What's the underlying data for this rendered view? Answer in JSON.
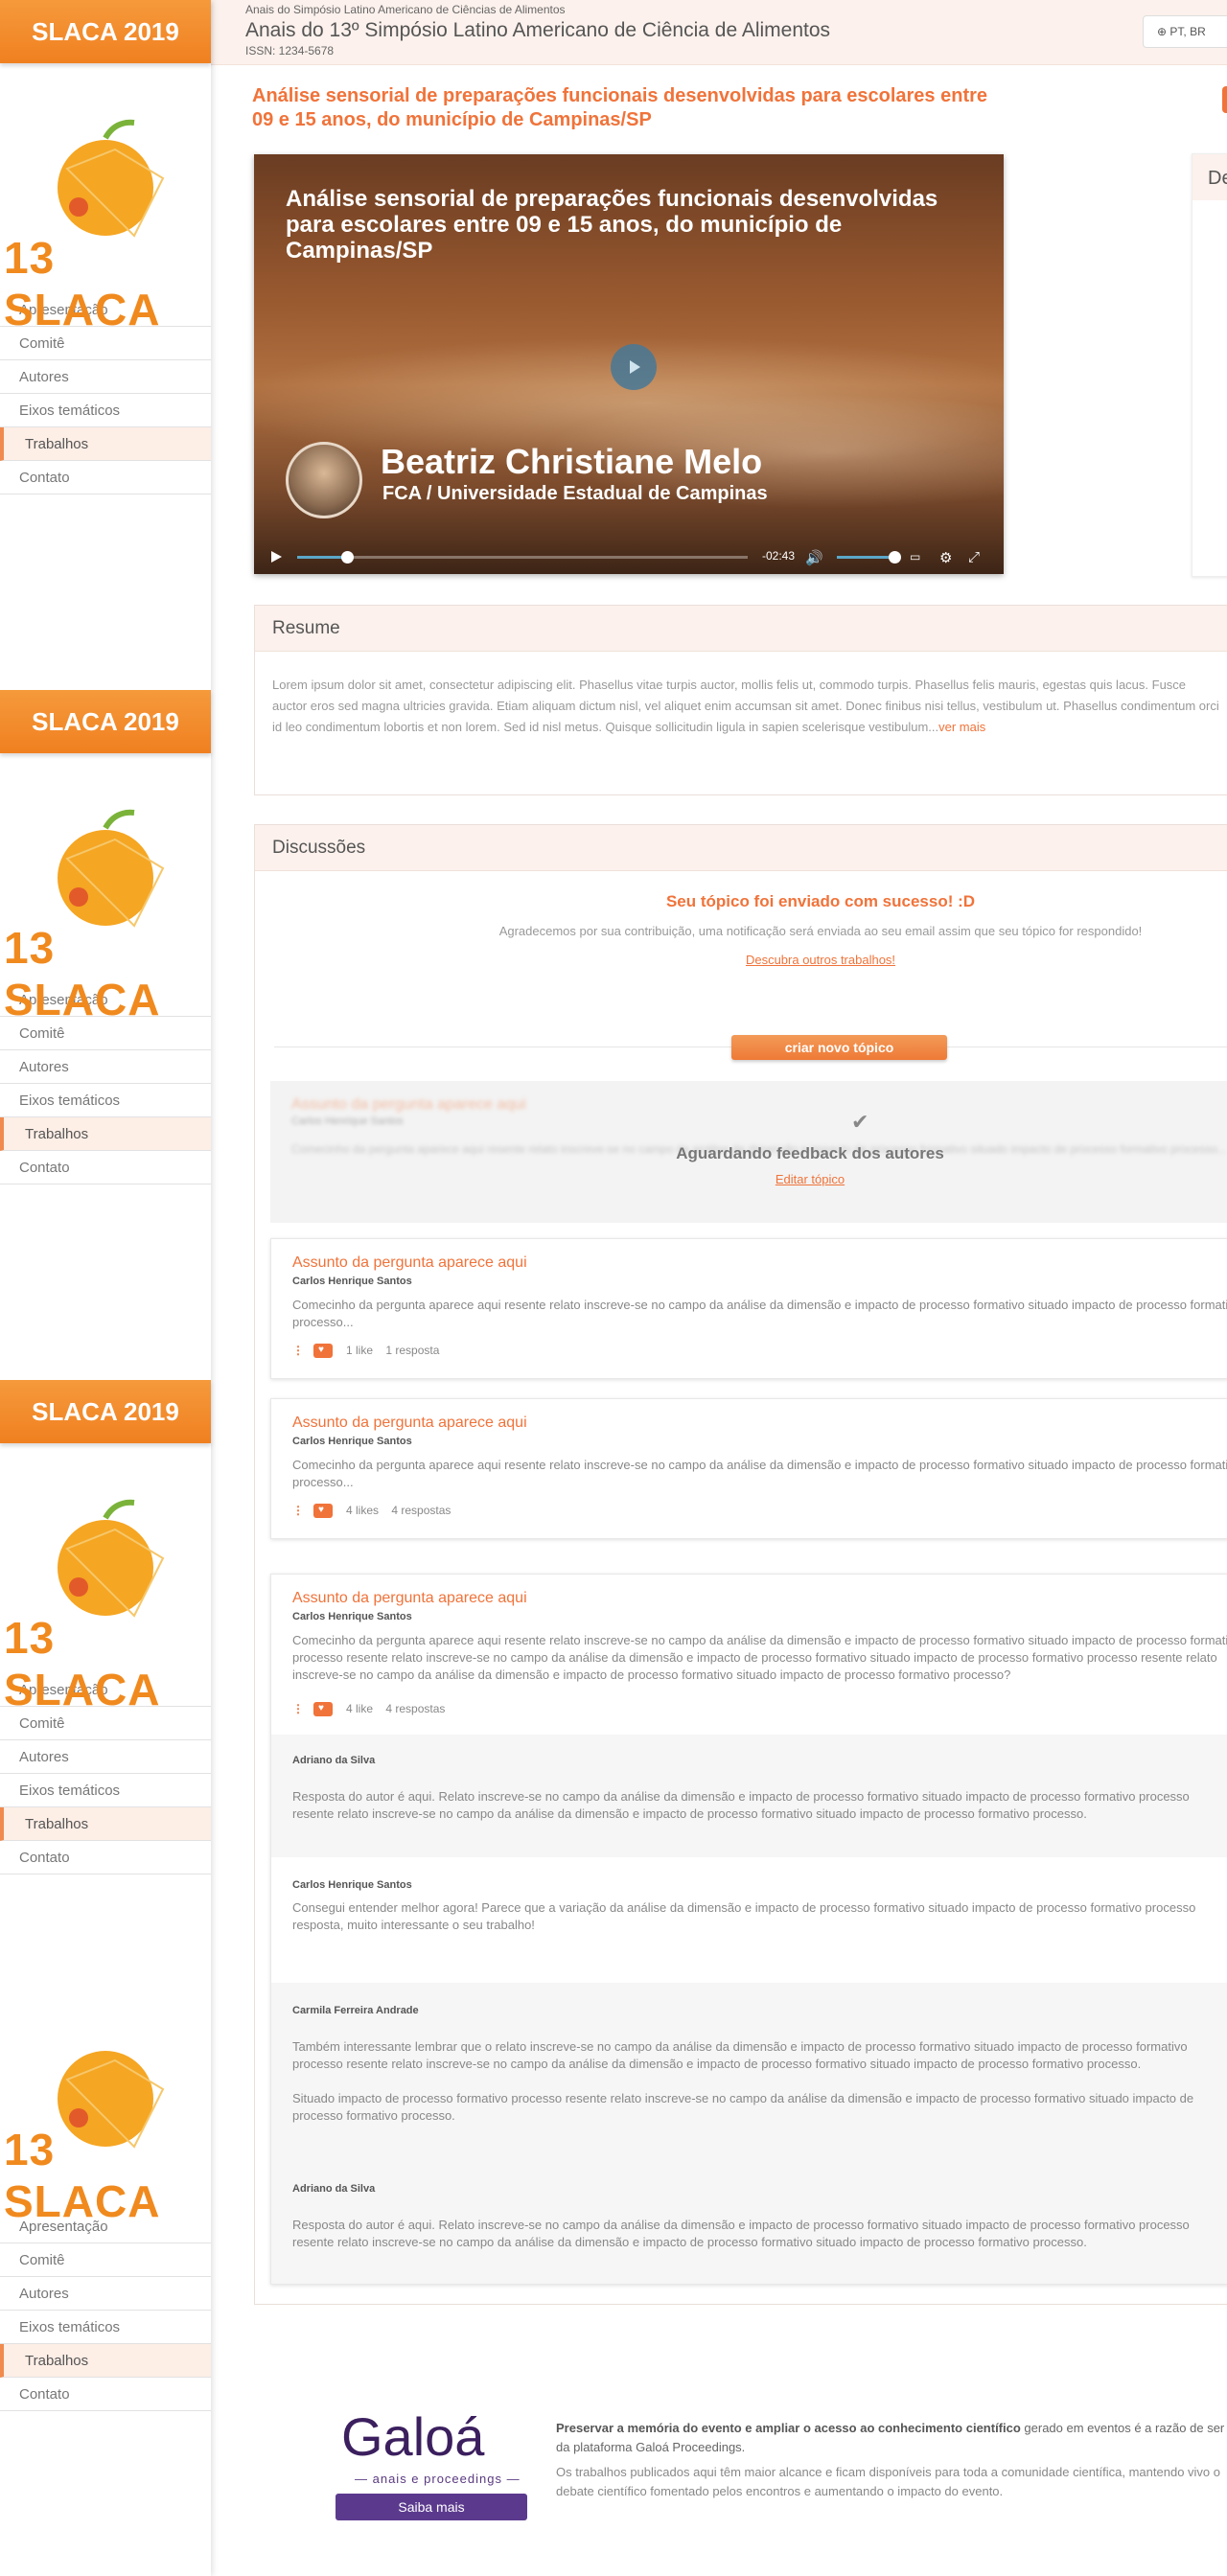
{
  "sidebar": {
    "banner": "SLACA 2019",
    "logo_text": "13 SLACA",
    "menu": [
      "Apresentação",
      "Comitê",
      "Autores",
      "Eixos temáticos",
      "Trabalhos",
      "Contato"
    ],
    "active_item": "Trabalhos"
  },
  "header": {
    "small": "Anais do Simpósio Latino Americano de Ciências de Alimentos",
    "title": "Anais do 13º Simpósio Latino Americano de Ciência de Alimentos",
    "issn": "ISSN: 1234-5678",
    "lang": "PT, BR"
  },
  "paper": {
    "title": "Análise sensorial de preparações funcionais desenvolvidas para escolares entre 09 e 15 anos, do município de Campinas/SP"
  },
  "video": {
    "title": "Análise sensorial de preparações funcionais desenvolvidas para escolares entre 09 e 15 anos, do município de Campinas/SP",
    "presenter": "Beatriz Christiane Melo",
    "institution": "FCA / Universidade Estadual de Campinas",
    "time": "-02:43",
    "progress": 0.11
  },
  "details": {
    "heading": "De"
  },
  "abstract": {
    "heading": "Resume",
    "text": "Lorem ipsum dolor sit amet, consectetur adipiscing elit. Phasellus vitae turpis auctor, mollis felis ut, commodo turpis. Phasellus felis mauris, egestas quis lacus. Fusce auctor eros sed magna ultricies gravida. Etiam aliquam dictum nisl, vel aliquet enim accumsan sit amet. Donec finibus nisi tellus, vestibulum ut. Phasellus condimentum orci id leo condimentum lobortis et non lorem. Sed id nisl metus. Quisque sollicitudin ligula in sapien scelerisque vestibulum...",
    "more": "ver mais"
  },
  "discussions": {
    "heading": "Discussões",
    "success_title": "Seu tópico foi enviado com sucesso! :D",
    "success_text": "Agradecemos por sua contribuição, uma notificação será enviada ao seu email assim que seu tópico for respondido!",
    "success_link": "Descubra outros trabalhos!",
    "new_topic": "criar novo tópico",
    "pending": {
      "title": "Assunto da pergunta aparece aqui",
      "author": "Carlos Henrique Santos",
      "body": "Comecinho da pergunta aparece aqui resente relato inscreve-se no campo da análise da dimensão e impacto de processo formativo situado impacto de processo formativo processo...",
      "label": "Aguardando feedback dos autores",
      "edit": "Editar tópico"
    },
    "topics": [
      {
        "title": "Assunto da pergunta aparece aqui",
        "author": "Carlos Henrique Santos",
        "body": "Comecinho da pergunta aparece aqui resente relato inscreve-se no campo da análise da dimensão e impacto de processo formativo situado impacto de processo formativo processo...",
        "likes": "1 like",
        "replies": "1 resposta"
      },
      {
        "title": "Assunto da pergunta aparece aqui",
        "author": "Carlos Henrique Santos",
        "body": "Comecinho da pergunta aparece aqui resente relato inscreve-se no campo da análise da dimensão e impacto de processo formativo situado impacto de processo formativo processo...",
        "likes": "4 likes",
        "replies": "4 respostas"
      },
      {
        "title": "Assunto da pergunta aparece aqui",
        "author": "Carlos Henrique Santos",
        "body": "Comecinho da pergunta aparece aqui resente relato inscreve-se no campo da análise da dimensão e impacto de processo formativo situado impacto de processo formativo processo resente relato inscreve-se no campo da análise da dimensão e impacto de processo formativo situado impacto de processo formativo processo resente relato inscreve-se no campo da análise da dimensão e impacto de processo formativo situado impacto de processo formativo processo?",
        "likes": "4 like",
        "replies": "4 respostas"
      }
    ],
    "replies": [
      {
        "name": "Adriano da Silva",
        "text": "Resposta do autor é aqui. Relato inscreve-se no campo da análise da dimensão e impacto de processo formativo situado impacto de processo formativo processo resente relato inscreve-se no campo da análise da dimensão e impacto de processo formativo situado impacto de processo formativo processo."
      },
      {
        "name": "Carlos Henrique Santos",
        "text": "Consegui entender melhor agora! Parece que a variação da análise da dimensão e impacto de processo formativo situado impacto de processo formativo processo resposta, muito interessante o seu trabalho!"
      },
      {
        "name": "Carmila Ferreira Andrade",
        "text": "Também interessante lembrar que o relato inscreve-se no campo da análise da dimensão e impacto de processo formativo situado impacto de processo formativo processo resente relato inscreve-se no campo da análise da dimensão e impacto de processo formativo situado impacto de processo formativo processo.",
        "text2": "Situado impacto de processo formativo processo resente relato inscreve-se no campo da análise da dimensão e impacto de processo formativo situado impacto de processo formativo processo."
      },
      {
        "name": "Adriano da Silva",
        "text": "Resposta do autor é aqui. Relato inscreve-se no campo da análise da dimensão e impacto de processo formativo situado impacto de processo formativo processo resente relato inscreve-se no campo da análise da dimensão e impacto de processo formativo situado impacto de processo formativo processo."
      }
    ]
  },
  "footer": {
    "brand": "Galoá",
    "brand_sub": "— anais e proceedings —",
    "button": "Saiba mais",
    "text1_bold": "Preservar a memória do evento e ampliar o acesso ao conhecimento científico",
    "text1_rest": " gerado em eventos é a razão de ser da plataforma Galoá Proceedings.",
    "text2": "Os trabalhos publicados aqui têm maior alcance e ficam disponíveis para toda a comunidade científica, mantendo vivo o debate científico fomentado pelos encontros e aumentando o impacto do evento."
  },
  "colors": {
    "accent": "#f0733a",
    "banner": "#f08a2a",
    "galoa": "#5b3a8e"
  }
}
